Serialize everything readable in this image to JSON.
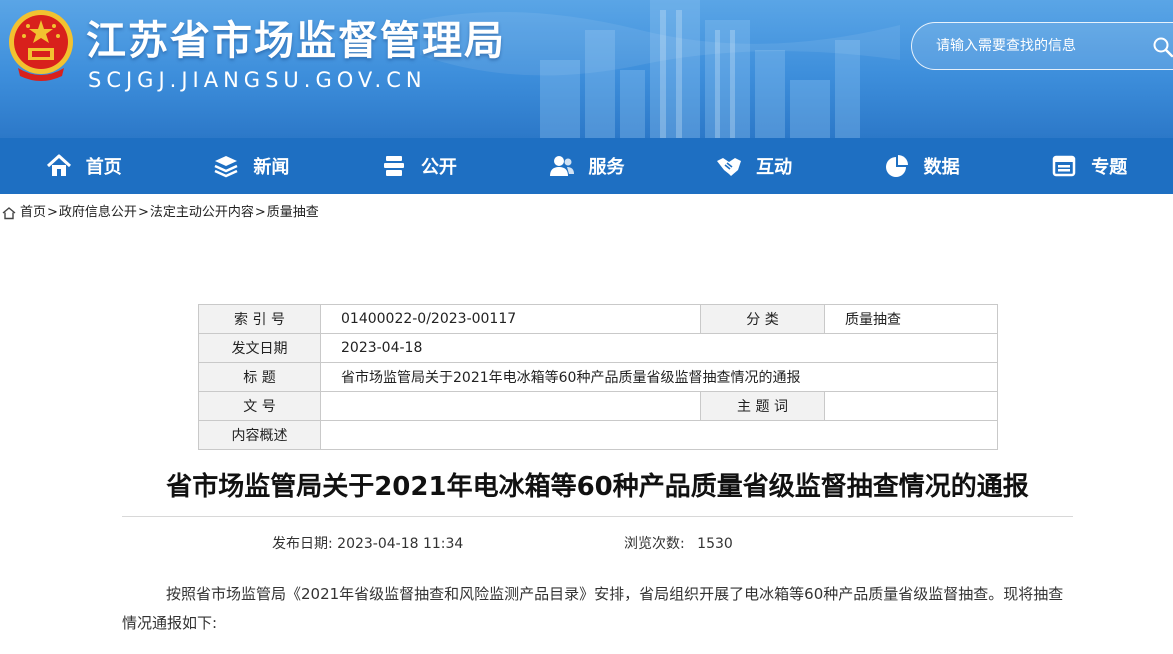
{
  "header": {
    "site_title": "江苏省市场监督管理局",
    "site_domain": "SCJGJ.JIANGSU.GOV.CN",
    "search_placeholder": "请输入需要查找的信息"
  },
  "nav": {
    "items": [
      {
        "label": "首页",
        "icon": "home-icon"
      },
      {
        "label": "新闻",
        "icon": "layers-icon"
      },
      {
        "label": "公开",
        "icon": "document-stack-icon"
      },
      {
        "label": "服务",
        "icon": "users-icon"
      },
      {
        "label": "互动",
        "icon": "handshake-icon"
      },
      {
        "label": "数据",
        "icon": "pie-chart-icon"
      },
      {
        "label": "专题",
        "icon": "calendar-icon"
      }
    ]
  },
  "breadcrumb": {
    "items": [
      "首页",
      "政府信息公开",
      "法定主动公开内容",
      "质量抽查"
    ],
    "separator": ">"
  },
  "meta": {
    "index_label": "索 引 号",
    "index_value": "01400022-0/2023-00117",
    "category_label": "分 类",
    "category_value": "质量抽查",
    "date_label": "发文日期",
    "date_value": "2023-04-18",
    "title_label": "标 题",
    "title_value": "省市场监管局关于2021年电冰箱等60种产品质量省级监督抽查情况的通报",
    "doc_no_label": "文 号",
    "doc_no_value": "",
    "keywords_label": "主 题 词",
    "keywords_value": "",
    "summary_label": "内容概述",
    "summary_value": ""
  },
  "article": {
    "title": "省市场监管局关于2021年电冰箱等60种产品质量省级监督抽查情况的通报",
    "publish_label": "发布日期:",
    "publish_value": "2023-04-18 11:34",
    "views_label": "浏览次数:",
    "views_value": "1530",
    "paragraph": "按照省市场监管局《2021年省级监督抽查和风险监测产品目录》安排，省局组织开展了电冰箱等60种产品质量省级监督抽查。现将抽查情况通报如下:"
  },
  "colors": {
    "header_blue": "#3d8edb",
    "nav_blue": "#1e6fc2",
    "emblem_red": "#d8201c",
    "emblem_gold": "#f2c230"
  }
}
